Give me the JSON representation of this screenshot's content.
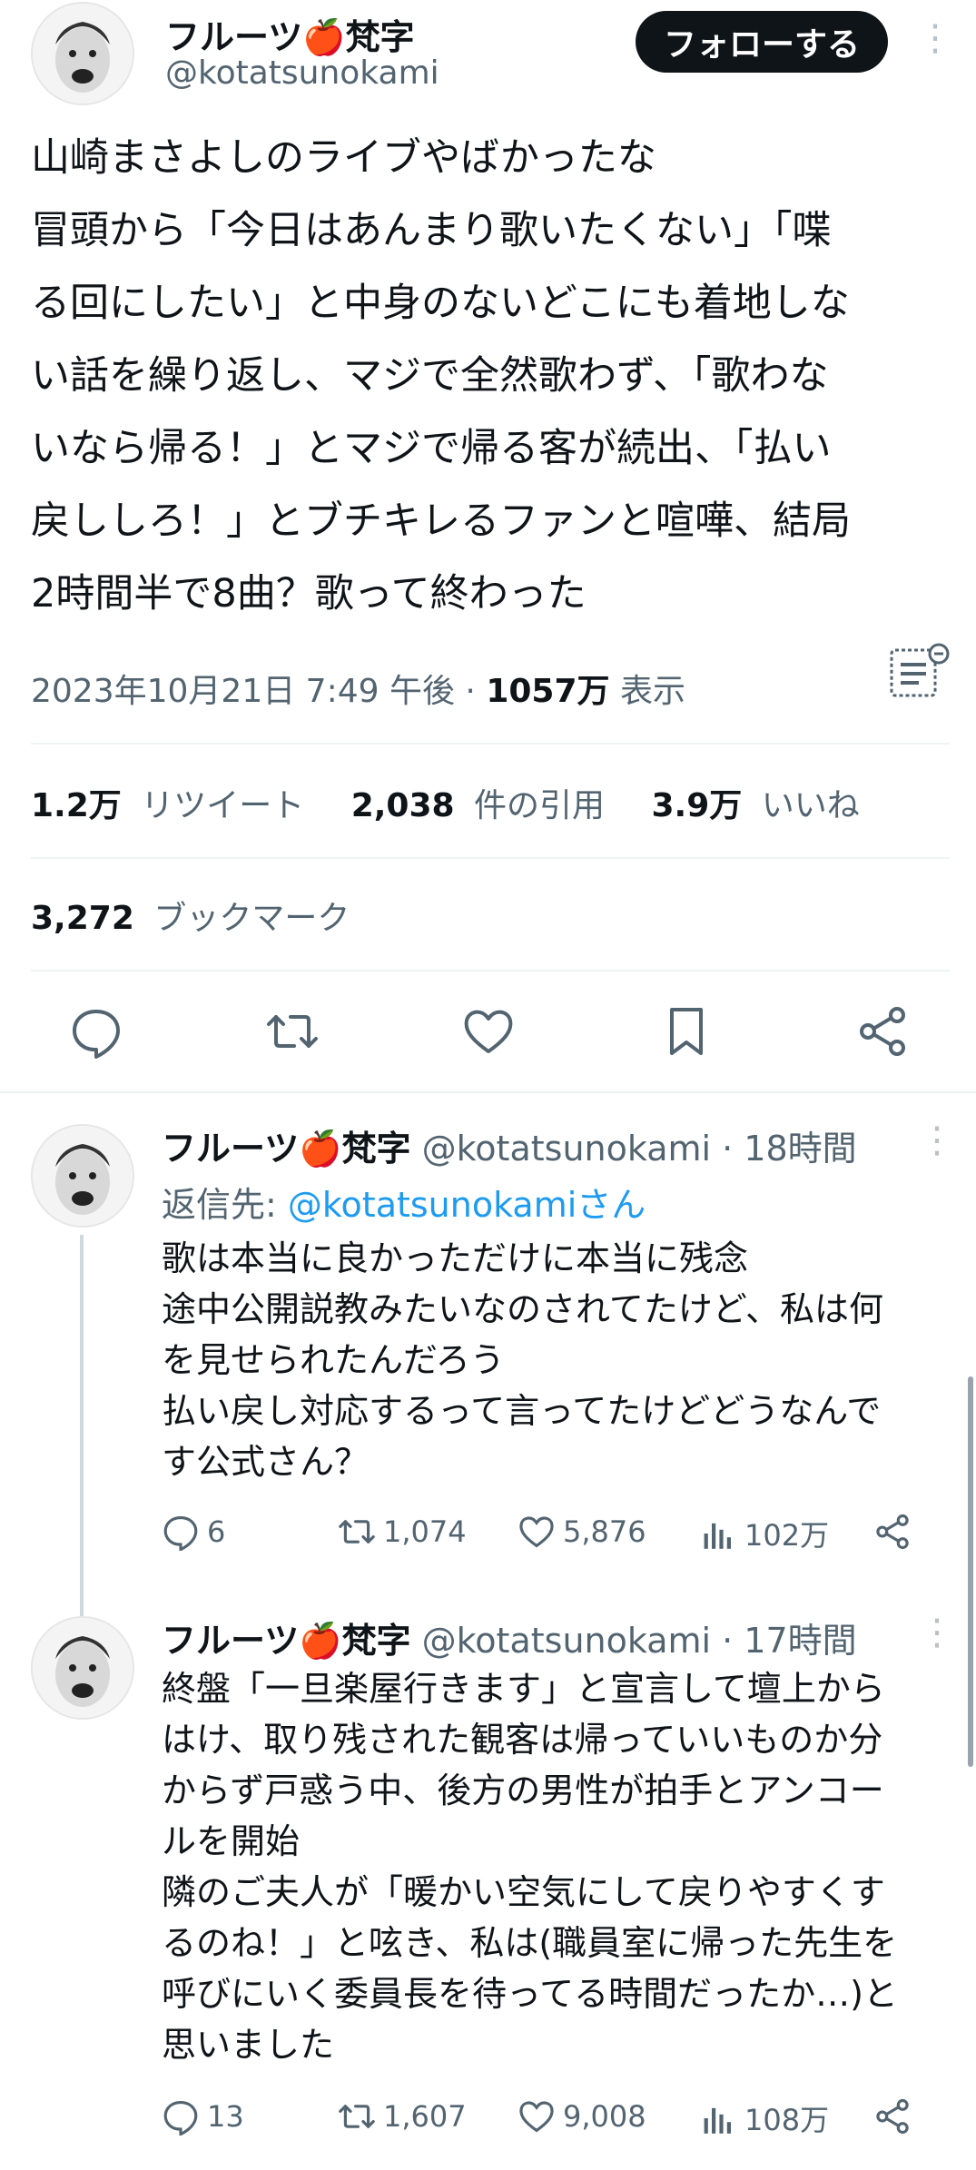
{
  "main_tweet": {
    "display_name": "フルーツ🍎梵字",
    "handle": "@kotatsunokami",
    "follow_label": "フォローする",
    "body_lines": [
      "山崎まさよしのライブやばかったな",
      "冒頭から「今日はあんまり歌いたくない」「喋",
      "る回にしたい」と中身のないどこにも着地しな",
      "い話を繰り返し、マジで全然歌わず、「歌わな",
      "いなら帰る！」とマジで帰る客が続出、「払い",
      "戻ししろ！」とブチキレるファンと喧嘩、結局",
      "2時間半で8曲？歌って終わった"
    ],
    "timestamp": "2023年10月21日 7:49 午後",
    "views_count": "1057万",
    "views_label": "表示",
    "stats": {
      "retweets_count": "1.2万",
      "retweets_label": "リツイート",
      "quotes_count": "2,038",
      "quotes_label": "件の引用",
      "likes_count": "3.9万",
      "likes_label": "いいね",
      "bookmarks_count": "3,272",
      "bookmarks_label": "ブックマーク"
    }
  },
  "replies": [
    {
      "display_name": "フルーツ🍎梵字",
      "handle": "@kotatsunokami",
      "time": "· 18時間",
      "reply_to_prefix": "返信先: ",
      "reply_to_handle": "@kotatsunokamiさん",
      "body_lines": [
        "歌は本当に良かっただけに本当に残念",
        "途中公開説教みたいなのされてたけど、私は何",
        "を見せられたんだろう",
        "払い戻し対応するって言ってたけどどうなんで",
        "す公式さん？"
      ],
      "replies": "6",
      "retweets": "1,074",
      "likes": "5,876",
      "views": "102万"
    },
    {
      "display_name": "フルーツ🍎梵字",
      "handle": "@kotatsunokami",
      "time": "· 17時間",
      "body_lines": [
        "終盤「一旦楽屋行きます」と宣言して壇上から",
        "はけ、取り残された観客は帰っていいものか分",
        "からず戸惑う中、後方の男性が拍手とアンコー",
        "ルを開始",
        "隣のご夫人が「暖かい空気にして戻りやすくす",
        "るのね！」と呟き、私は(職員室に帰った先生を",
        "呼びにいく委員長を待ってる時間だったか…)と",
        "思いました"
      ],
      "replies": "13",
      "retweets": "1,607",
      "likes": "9,008",
      "views": "108万"
    }
  ],
  "colors": {
    "text": "#0f1419",
    "secondary": "#536471",
    "link": "#1d9bf0",
    "divider": "#eff3f4"
  }
}
